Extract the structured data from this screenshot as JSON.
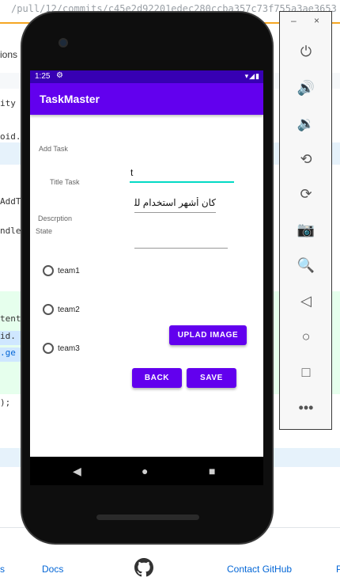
{
  "browser": {
    "url_fragment": "/pull/12/commits/c45e2d92201edec280ccba357c73f755a3ae3653"
  },
  "ide_background": {
    "tab_text": "ions",
    "code_lines": [
      "ity",
      "oid.",
      "AddT",
      "ndle",
      "tent",
      "id.",
      ".ge",
      ");"
    ]
  },
  "footer": {
    "left_fragment": "s",
    "docs": "Docs",
    "contact": "Contact GitHub",
    "right_fragment": "P"
  },
  "phone": {
    "status": {
      "time": "1:25"
    },
    "app": {
      "title": "TaskMaster"
    },
    "form": {
      "add_task_label": "Add Task",
      "title_label": "Title Task",
      "title_value": "t",
      "description_label": "Descrption",
      "description_value": "كان أشهر استخدام للح",
      "state_label": "State",
      "state_value": ""
    },
    "teams": [
      "team1",
      "team2",
      "team3"
    ],
    "buttons": {
      "upload": "UPLAD IMAGE",
      "back": "BACK",
      "save": "SAVE"
    }
  },
  "emulator": {
    "window_controls": {
      "minimize": "–",
      "close": "×"
    }
  },
  "colors": {
    "primary": "#6200ee",
    "primary_dark": "#3700b3",
    "accent": "#03dac5"
  }
}
